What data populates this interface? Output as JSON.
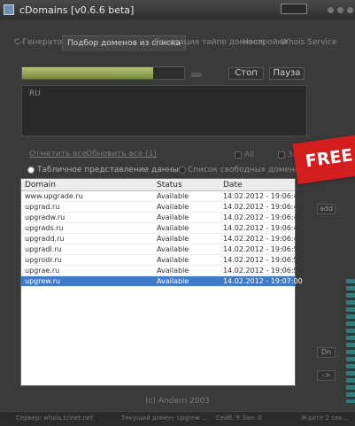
{
  "window": {
    "title": "cDomains [v0.6.6 beta]"
  },
  "tabs": [
    "С-Генератор",
    "Подбор доменов из списка",
    "Генерация тайпо доменов",
    "Настройки",
    "Whois Service"
  ],
  "controls": {
    "stop_label": "Стоп",
    "pause_label": "Пауза",
    "progress": 0.81
  },
  "textarea": {
    "value": "RU"
  },
  "links": {
    "mark_all": "Отметить все",
    "clear_all": "Обновить все (1)"
  },
  "options": {
    "all_label": "All",
    "free_label": "Занятые",
    "table_view_label": "Табличное представление данных",
    "free_list_label": "Список свободных доменов(9)"
  },
  "grid": {
    "columns": [
      "Domain",
      "Status",
      "Date"
    ],
    "rows": [
      {
        "domain": "www.upgrade.ru",
        "status": "Available",
        "date": "14.02.2012 - 19:06:43"
      },
      {
        "domain": "upgrad.ru",
        "status": "Available",
        "date": "14.02.2012 - 19:06:43"
      },
      {
        "domain": "upgradw.ru",
        "status": "Available",
        "date": "14.02.2012 - 19:06:45"
      },
      {
        "domain": "upgrads.ru",
        "status": "Available",
        "date": "14.02.2012 - 19:06:47"
      },
      {
        "domain": "upgradd.ru",
        "status": "Available",
        "date": "14.02.2012 - 19:06:49"
      },
      {
        "domain": "upgradl.ru",
        "status": "Available",
        "date": "14.02.2012 - 19:06:52"
      },
      {
        "domain": "upgrodr.ru",
        "status": "Available",
        "date": "14.02.2012 - 19:06:54"
      },
      {
        "domain": "upgrae.ru",
        "status": "Available",
        "date": "14.02.2012 - 19:06:58"
      },
      {
        "domain": "upgrew.ru",
        "status": "Available",
        "date": "14.02.2012 - 19:07:00"
      }
    ],
    "selected_row": 8
  },
  "side_buttons": {
    "top": "add",
    "mid": "Dn",
    "bottom": "->"
  },
  "footer": "(c) Andern 2003",
  "statusbar": {
    "left": "Сервер: whois.tcinet.net",
    "middle": "Текущий домен: upgrew ...",
    "count": "Сейб: 9 Зан: 0",
    "right": "Ждите 2 сек..."
  },
  "badge": "FREE",
  "colors": {
    "window_bg": "#3a3a3a",
    "selection": "#3f7ac8",
    "badge": "#d41e1e",
    "progress": "#9aa95a"
  }
}
